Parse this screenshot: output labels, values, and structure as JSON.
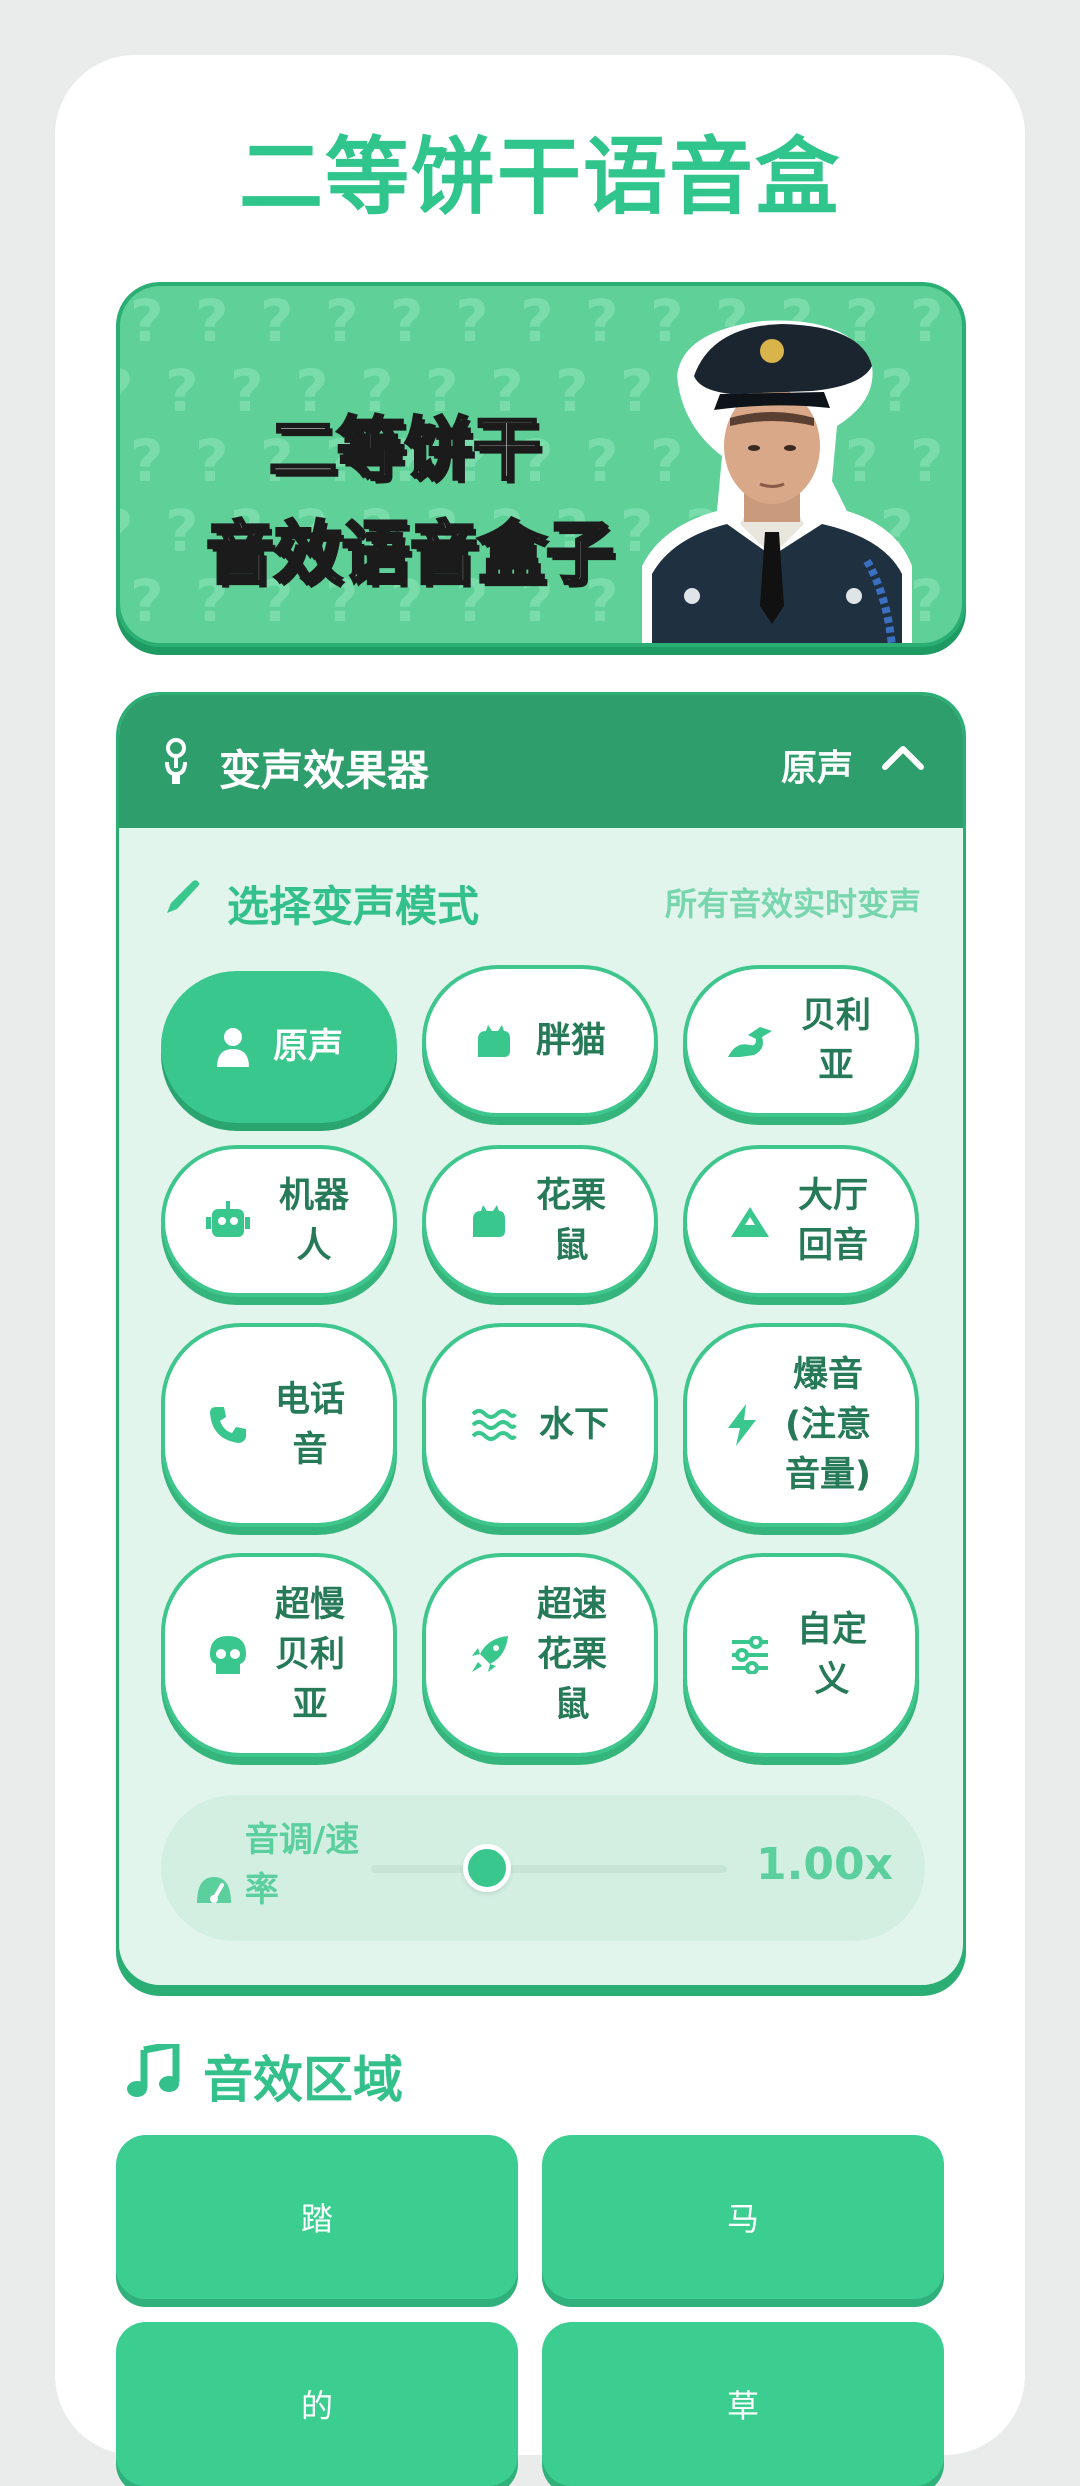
{
  "app": {
    "title": "二等饼干语音盒"
  },
  "banner": {
    "line1": "二等饼干",
    "line2": "音效语音盒子"
  },
  "voice_changer": {
    "title": "变声效果器",
    "current_mode": "原声",
    "select_title": "选择变声模式",
    "select_hint": "所有音效实时变声",
    "modes": [
      {
        "label": "原声",
        "icon": "user-icon",
        "active": true
      },
      {
        "label": "胖猫",
        "icon": "cat-icon"
      },
      {
        "label": "贝利亚",
        "icon": "dragon-icon"
      },
      {
        "label": "机器人",
        "icon": "robot-icon"
      },
      {
        "label": "花栗鼠",
        "icon": "cat-icon"
      },
      {
        "label": "大厅回音",
        "icon": "mountain-icon"
      },
      {
        "label": "电话音",
        "icon": "phone-icon"
      },
      {
        "label": "水下",
        "icon": "water-icon"
      },
      {
        "label": "爆音(注意音量)",
        "icon": "bolt-icon"
      },
      {
        "label": "超慢贝利亚",
        "icon": "skull-icon"
      },
      {
        "label": "超速花栗鼠",
        "icon": "rocket-icon"
      },
      {
        "label": "自定义",
        "icon": "sliders-icon"
      }
    ],
    "pitch": {
      "label": "音调/速率",
      "value_text": "1.00x",
      "level": 0.3
    }
  },
  "effects": {
    "title": "音效区域",
    "buttons": [
      "踏",
      "马",
      "的",
      "草"
    ]
  },
  "colors": {
    "accent": "#3ac78e",
    "dark_green": "#2e9e6c",
    "panel_bg": "#e2f5ec"
  }
}
